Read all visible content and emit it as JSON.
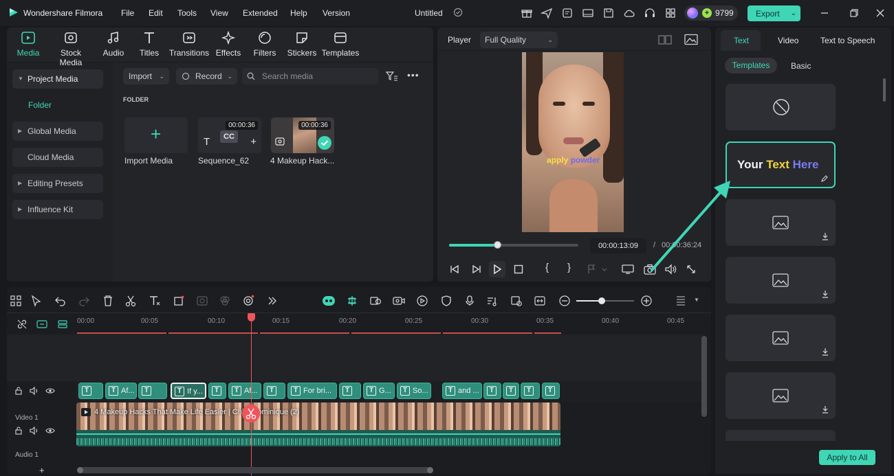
{
  "app": {
    "name": "Wondershare Filmora",
    "project_title": "Untitled",
    "credits": "9799",
    "export_label": "Export"
  },
  "menu": [
    "File",
    "Edit",
    "Tools",
    "View",
    "Extended",
    "Help",
    "Version"
  ],
  "toolbar_tabs": [
    {
      "label": "Media",
      "icon": "media-icon"
    },
    {
      "label": "Stock Media",
      "icon": "stock-media-icon"
    },
    {
      "label": "Audio",
      "icon": "music-note-icon"
    },
    {
      "label": "Titles",
      "icon": "text-t-icon"
    },
    {
      "label": "Transitions",
      "icon": "transitions-icon"
    },
    {
      "label": "Effects",
      "icon": "sparkle-icon"
    },
    {
      "label": "Filters",
      "icon": "filter-icon"
    },
    {
      "label": "Stickers",
      "icon": "sticker-icon"
    },
    {
      "label": "Templates",
      "icon": "templates-icon"
    }
  ],
  "sidebar": {
    "items": [
      "Project Media",
      "Folder",
      "Global Media",
      "Cloud Media",
      "Editing Presets",
      "Influence Kit"
    ]
  },
  "media_toolbar": {
    "import_label": "Import",
    "record_label": "Record",
    "search_placeholder": "Search media"
  },
  "folder_heading": "FOLDER",
  "media_items": [
    {
      "label": "Import Media",
      "duration": ""
    },
    {
      "label": "Sequence_62",
      "duration": "00:00:36"
    },
    {
      "label": "4 Makeup Hack...",
      "duration": "00:00:36"
    }
  ],
  "player": {
    "label": "Player",
    "quality": "Full Quality",
    "current_time": "00:00:13:09",
    "separator": "/",
    "total_time": "00:00:36:24",
    "progress": 0.37,
    "caption_text_1": "apply",
    "caption_text_2": "powder"
  },
  "right_panel": {
    "tabs": [
      "Text",
      "Video",
      "Text to Speech"
    ],
    "subtabs": [
      "Templates",
      "Basic"
    ],
    "template_preview": {
      "word1": "Your",
      "word2": "Text",
      "word3": "Here"
    },
    "apply_all_label": "Apply to All"
  },
  "timeline": {
    "ruler": [
      "00:00",
      "00:05",
      "00:10",
      "00:15",
      "00:20",
      "00:25",
      "00:30",
      "00:35",
      "00:40",
      "00:45"
    ],
    "zoom_level": 0.44,
    "text_clips": [
      "",
      "Af...",
      "",
      "If y...",
      "",
      "Af...",
      "",
      "For bri...",
      "",
      "G...",
      "So...",
      "and ...",
      "",
      "",
      ""
    ],
    "video_track_label": "Video 1",
    "audio_track_label": "Audio 1",
    "video_clip_title": "4 Makeup Hacks That Make Life Easier | Chi... Dominique (2)"
  },
  "colors": {
    "accent": "#3fd6b6",
    "export_bg": "#3fd6b6",
    "playhead": "#f0545b",
    "text_clip": "#2f8f7c"
  }
}
